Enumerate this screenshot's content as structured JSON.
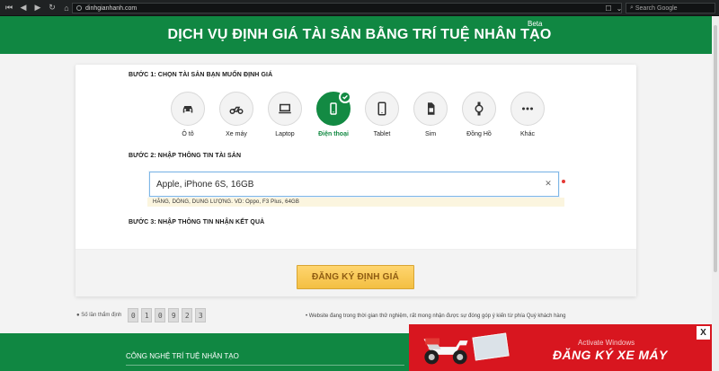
{
  "browser": {
    "url": "dinhgianhanh.com",
    "search_placeholder": "Search Google"
  },
  "hero": {
    "title": "DỊCH VỤ ĐỊNH GIÁ TÀI SẢN BẰNG TRÍ TUỆ NHÂN TẠO",
    "badge": "Beta"
  },
  "steps": {
    "step1": "BƯỚC 1: CHỌN TÀI SẢN BẠN MUỐN ĐỊNH GIÁ",
    "step2": "BƯỚC 2: NHẬP THÔNG TIN TÀI SẢN",
    "step3": "BƯỚC 3: NHẬP THÔNG TIN NHẬN KẾT QUẢ"
  },
  "assets": [
    {
      "label": "Ô tô",
      "icon": "car-icon",
      "active": false
    },
    {
      "label": "Xe máy",
      "icon": "motorbike-icon",
      "active": false
    },
    {
      "label": "Laptop",
      "icon": "laptop-icon",
      "active": false
    },
    {
      "label": "Điện thoại",
      "icon": "phone-icon",
      "active": true
    },
    {
      "label": "Tablet",
      "icon": "tablet-icon",
      "active": false
    },
    {
      "label": "Sim",
      "icon": "sim-icon",
      "active": false
    },
    {
      "label": "Đồng Hồ",
      "icon": "watch-icon",
      "active": false
    },
    {
      "label": "Khác",
      "icon": "more-icon",
      "active": false
    }
  ],
  "input": {
    "value": "Apple, iPhone 6S, 16GB",
    "hint": "HÃNG, DÒNG, DUNG LƯỢNG. VD: Oppo, F3 Plus, 64GB"
  },
  "action": {
    "button": "ĐĂNG KÝ ĐỊNH GIÁ"
  },
  "stats": {
    "label": "Số lần thẩm định",
    "digits": [
      "0",
      "1",
      "0",
      "9",
      "2",
      "3"
    ]
  },
  "notice": "• Website đang trong thời gian thử nghiệm, rất mong nhận được sự đóng góp ý kiến từ phía Quý khách hàng",
  "footer": {
    "title": "CÔNG NGHỆ TRÍ TUỆ NHÂN TẠO"
  },
  "ad": {
    "title": "ĐĂNG KÝ XE MÁY",
    "close": "X",
    "overlay": "Activate Windows"
  },
  "colors": {
    "green": "#108742",
    "gold": "#f3bf42",
    "red": "#d8161f"
  }
}
